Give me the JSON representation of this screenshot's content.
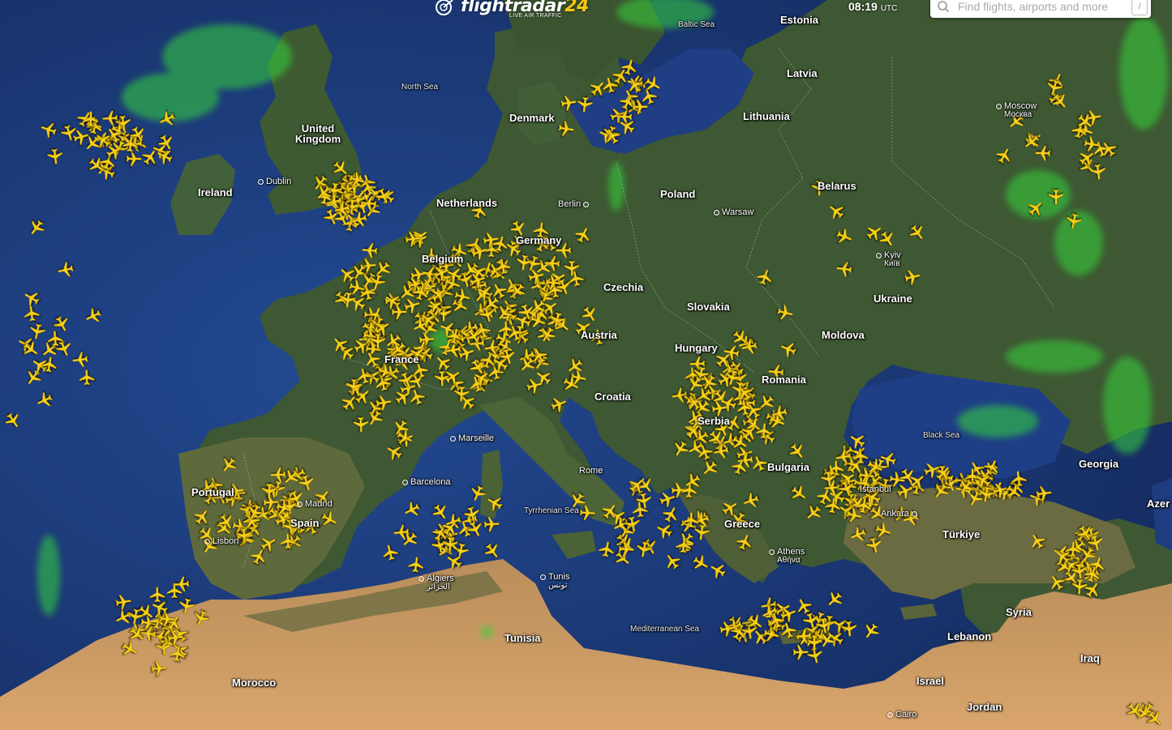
{
  "app": {
    "brand": "flightradar",
    "brand_number": "24",
    "tagline": "LIVE AIR TRAFFIC"
  },
  "clock": {
    "time": "08:19",
    "timezone": "UTC"
  },
  "search": {
    "placeholder": "Find flights, airports and more"
  },
  "icons": {
    "logo": "radar-logo-icon",
    "search": "search-icon",
    "plane": "airplane-icon",
    "filter": "filter-icon"
  },
  "colors": {
    "plane": "#f7d117",
    "weather": "#35d43a",
    "sea": "#1d3a7c",
    "land": "#3f5a33",
    "desert": "#c9945e"
  },
  "countries": [
    "Estonia",
    "Latvia",
    "Lithuania",
    "Denmark",
    "United Kingdom",
    "Ireland",
    "Netherlands",
    "Belgium",
    "Germany",
    "Poland",
    "Belarus",
    "Czechia",
    "Slovakia",
    "Austria",
    "Hungary",
    "Ukraine",
    "Moldova",
    "Romania",
    "France",
    "Croatia",
    "Serbia",
    "Bulgaria",
    "Portugal",
    "Spain",
    "Greece",
    "Türkiye",
    "Syria",
    "Lebanon",
    "Israel",
    "Jordan",
    "Iraq",
    "Tunisia",
    "Morocco",
    "Georgia",
    "Azer"
  ],
  "cities": [
    {
      "name": "Dublin"
    },
    {
      "name": "Berlin"
    },
    {
      "name": "Warsaw"
    },
    {
      "name": "Kyiv",
      "local": "Київ"
    },
    {
      "name": "Moscow",
      "local": "Москва"
    },
    {
      "name": "Marseille"
    },
    {
      "name": "Rome"
    },
    {
      "name": "Barcelona"
    },
    {
      "name": "Madrid"
    },
    {
      "name": "Lisbon"
    },
    {
      "name": "Algiers",
      "local": "الجزائر"
    },
    {
      "name": "Tunis",
      "local": "تونس"
    },
    {
      "name": "Athens",
      "local": "Αθήνα"
    },
    {
      "name": "Istanbul"
    },
    {
      "name": "Ankara"
    },
    {
      "name": "Cairo"
    }
  ],
  "seas": [
    "North Sea",
    "Baltic Sea",
    "Black Sea",
    "Mediterranean Sea",
    "Tyrrhenian Sea"
  ]
}
